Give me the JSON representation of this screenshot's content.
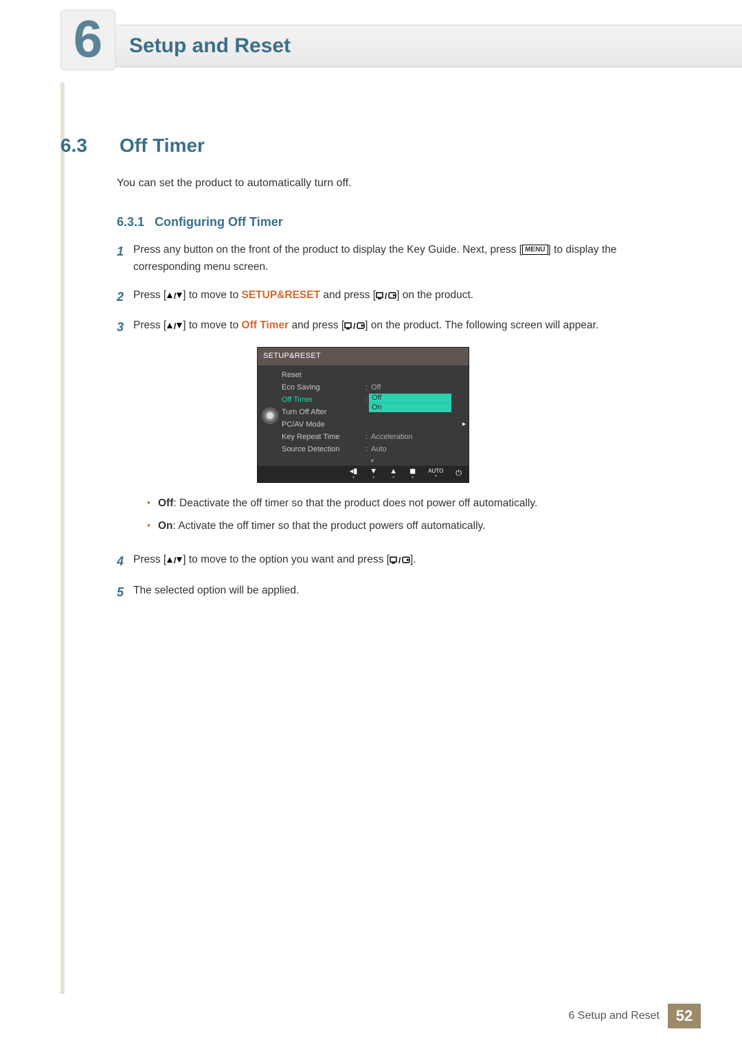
{
  "chapter": {
    "number": "6",
    "title": "Setup and Reset"
  },
  "section": {
    "number": "6.3",
    "title": "Off Timer"
  },
  "intro": "You can set the product to automatically turn off.",
  "subsection": {
    "number": "6.3.1",
    "title": "Configuring Off Timer"
  },
  "steps": {
    "s1_a": "Press any button on the front of the product to display the Key Guide. Next, press [",
    "s1_menu": "MENU",
    "s1_b": "] to display the corresponding menu screen.",
    "s2_a": "Press [",
    "s2_b": "] to move to ",
    "s2_kw": "SETUP&RESET",
    "s2_c": " and press [",
    "s2_d": "] on the product.",
    "s3_a": "Press [",
    "s3_b": "] to move to ",
    "s3_kw": "Off Timer",
    "s3_c": " and press [",
    "s3_d": "] on the product. The following screen will appear.",
    "s4_a": "Press [",
    "s4_b": "] to move to the option you want and press [",
    "s4_c": "].",
    "s5": "The selected option will be applied.",
    "num1": "1",
    "num2": "2",
    "num3": "3",
    "num4": "4",
    "num5": "5"
  },
  "osd": {
    "header": "SETUP&RESET",
    "rows": [
      {
        "label": "Reset",
        "value": ""
      },
      {
        "label": "Eco Saving",
        "value": "Off"
      },
      {
        "label": "Off Timer",
        "value": "",
        "selected": true
      },
      {
        "label": "Turn Off After",
        "value": ""
      },
      {
        "label": "PC/AV Mode",
        "value": ""
      },
      {
        "label": "Key Repeat Time",
        "value": "Acceleration"
      },
      {
        "label": "Source Detection",
        "value": "Auto"
      }
    ],
    "dropdown": {
      "off": "Off",
      "on": "On"
    },
    "footer_auto": "AUTO"
  },
  "bullets": {
    "off_key": "Off",
    "off_text": ": Deactivate the off timer so that the product does not power off automatically.",
    "on_key": "On",
    "on_text": ": Activate the off timer so that the product powers off automatically."
  },
  "footer": {
    "label": "6 Setup and Reset",
    "page": "52"
  }
}
